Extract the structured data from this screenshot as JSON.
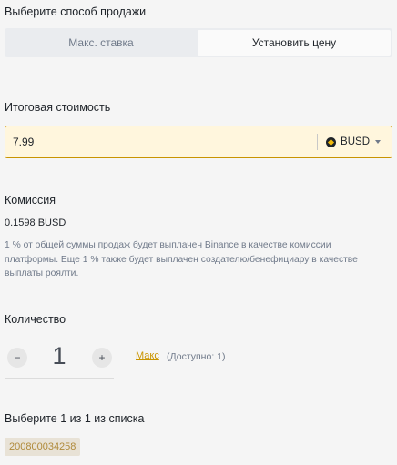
{
  "sale_method": {
    "heading": "Выберите способ продажи",
    "options": [
      "Макс. ставка",
      "Установить цену"
    ],
    "selected": "Установить цену"
  },
  "total_cost": {
    "heading": "Итоговая стоимость",
    "value": "7.99",
    "currency": "BUSD"
  },
  "fee": {
    "heading": "Комиссия",
    "value": "0.1598 BUSD",
    "description": "1 % от общей суммы продаж будет выплачен Binance в качестве комиссии платформы. Еще 1 % также будет выплачен создателю/бенефициару в качестве выплаты роялти."
  },
  "quantity": {
    "heading": "Количество",
    "minus": "−",
    "value": "1",
    "plus": "+",
    "max_label": "Макс",
    "available": "(Доступно: 1)"
  },
  "selection": {
    "heading": "Выберите 1 из 1 из списка",
    "items": [
      "200800034258"
    ]
  },
  "colors": {
    "accent": "#c99400",
    "input_bg": "#fff6dd",
    "page_bg": "#f5f5f5"
  }
}
